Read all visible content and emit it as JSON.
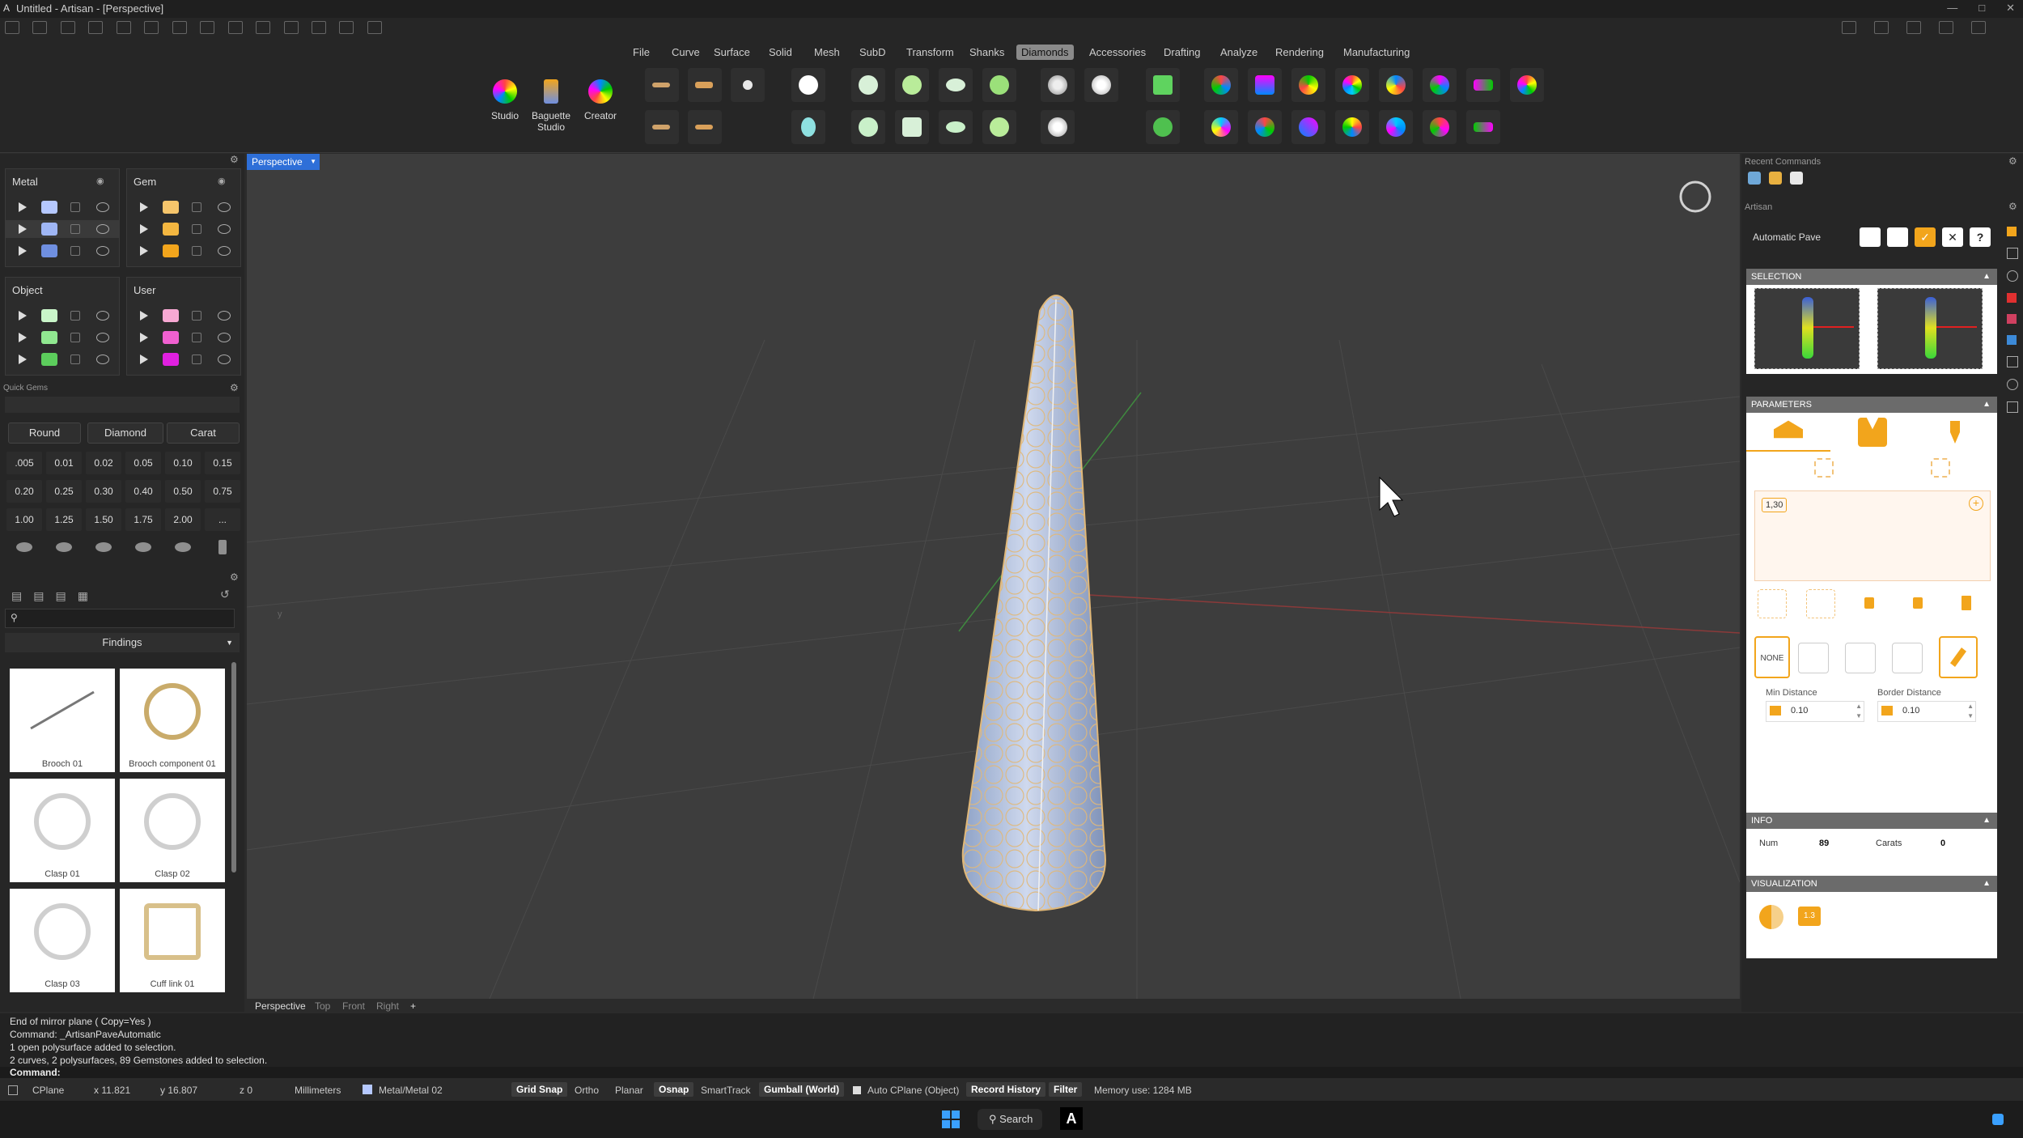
{
  "window": {
    "title": "Untitled - Artisan - [Perspective]"
  },
  "menu": [
    "File",
    "Curve",
    "Surface",
    "Solid",
    "Mesh",
    "SubD",
    "Transform",
    "Shanks",
    "Diamonds",
    "Accessories",
    "Drafting",
    "Analyze",
    "Rendering",
    "Manufacturing"
  ],
  "menu_active": "Diamonds",
  "ribbon_big": [
    {
      "label": "Studio"
    },
    {
      "label": "Baguette Studio"
    },
    {
      "label": "Creator"
    }
  ],
  "layers": {
    "metal_title": "Metal",
    "gem_title": "Gem",
    "object_title": "Object",
    "user_title": "User",
    "metal_colors": [
      "#b5c8ff",
      "#9fb6f5",
      "#6f8fe0"
    ],
    "gem_colors": [
      "#f6c56b",
      "#f3b640",
      "#f2a51c"
    ],
    "object_colors": [
      "#c9f5c9",
      "#90e890",
      "#5ccd5c"
    ],
    "user_colors": [
      "#f7a8d3",
      "#f060d0",
      "#e020e0"
    ]
  },
  "quick_gems": {
    "title": "Quick Gems",
    "shape": "Round",
    "type": "Diamond",
    "unit": "Carat",
    "sizes": [
      ".005",
      "0.01",
      "0.02",
      "0.05",
      "0.10",
      "0.15",
      "0.20",
      "0.25",
      "0.30",
      "0.40",
      "0.50",
      "0.75",
      "1.00",
      "1.25",
      "1.50",
      "1.75",
      "2.00",
      "..."
    ]
  },
  "library": {
    "category": "Findings",
    "items": [
      "Brooch 01",
      "Brooch component 01",
      "Clasp 01",
      "Clasp 02",
      "Clasp 03",
      "Cuff link 01"
    ]
  },
  "viewport": {
    "active": "Perspective",
    "tabs": [
      "Perspective",
      "Top",
      "Front",
      "Right",
      "+"
    ]
  },
  "right": {
    "recent": "Recent Commands",
    "artisan": "Artisan",
    "command": "Automatic Pave",
    "selection": "SELECTION",
    "parameters": "PARAMETERS",
    "size_value": "1,30",
    "none_label": "NONE",
    "min_distance_label": "Min Distance",
    "border_distance_label": "Border Distance",
    "min_distance": "0.10",
    "border_distance": "0.10",
    "info": "INFO",
    "num_label": "Num",
    "num": "89",
    "carats_label": "Carats",
    "carats": "0",
    "visualization": "VISUALIZATION",
    "vis_badge": "1.3",
    "accent": "#f2a51c"
  },
  "command_history": [
    "End of mirror plane ( Copy=Yes )",
    "Command: _ArtisanPaveAutomatic",
    "1 open polysurface added to selection.",
    "2 curves, 2 polysurfaces, 89 Gemstones added to selection."
  ],
  "command_prompt": "Command:",
  "status": {
    "cplane": "CPlane",
    "x": "x 11.821",
    "y": "y 16.807",
    "z": "z 0",
    "units": "Millimeters",
    "layer": "Metal/Metal 02",
    "grid_snap": "Grid Snap",
    "ortho": "Ortho",
    "planar": "Planar",
    "osnap": "Osnap",
    "smarttrack": "SmartTrack",
    "gumball": "Gumball (World)",
    "auto_cplane": "Auto CPlane (Object)",
    "record_history": "Record History",
    "filter": "Filter",
    "memory": "Memory use: 1284 MB"
  },
  "taskbar": {
    "search": "Search"
  }
}
